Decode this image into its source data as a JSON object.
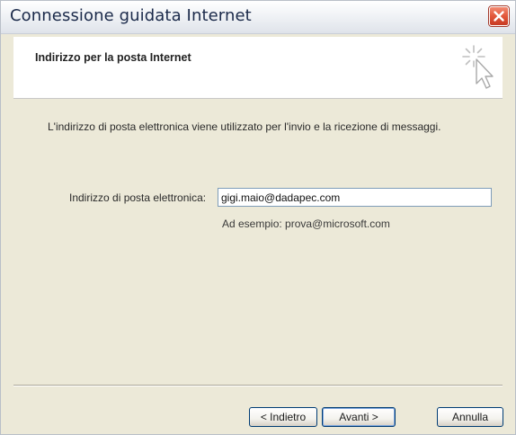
{
  "window": {
    "title": "Connessione guidata Internet",
    "close_icon": "close-icon"
  },
  "header": {
    "title": "Indirizzo per la posta Internet",
    "icon": "wizard-cursor-sparkle-icon"
  },
  "content": {
    "intro": "L'indirizzo di posta elettronica viene utilizzato per l'invio e la ricezione di messaggi.",
    "email_label": "Indirizzo di posta elettronica:",
    "email_value": "gigi.maio@dadapec.com",
    "example": "Ad esempio: prova@microsoft.com"
  },
  "buttons": {
    "back": "< Indietro",
    "next": "Avanti >",
    "cancel": "Annulla"
  },
  "colors": {
    "close_button": "#e2573b",
    "face": "#ece9d8",
    "input_border": "#7f9db9"
  }
}
